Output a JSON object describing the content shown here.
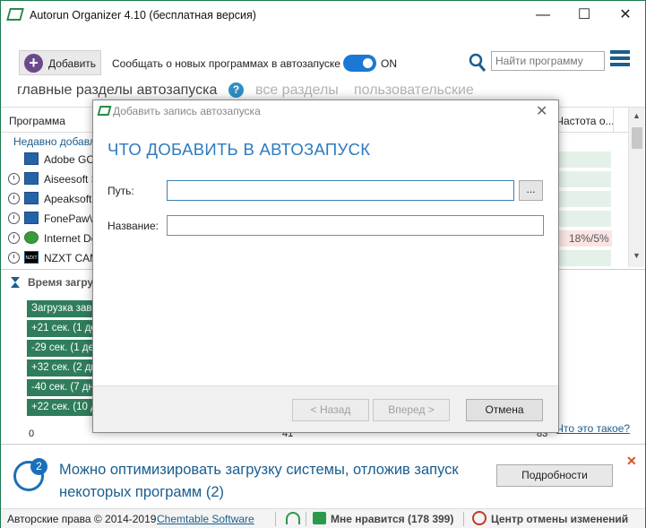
{
  "window": {
    "title": "Autorun Organizer 4.10 (бесплатная версия)",
    "controls": {
      "minimize": "—",
      "maximize": "☐",
      "close": "✕"
    }
  },
  "toolbar": {
    "add_label": "Добавить",
    "add_symbol": "+",
    "notify_text": "Сообщать о новых программах в автозапуске",
    "toggle_label": "ON",
    "toggle_on": true,
    "search_placeholder": "Найти программу"
  },
  "sections": {
    "active": "главные разделы автозапуска",
    "help": "?",
    "all": "все разделы",
    "user": "пользовательские"
  },
  "list": {
    "col_program": "Программа",
    "col_freq": "Частота о...",
    "group": "Недавно добавл...",
    "rows": [
      {
        "name": "Adobe GC...",
        "value": ""
      },
      {
        "name": "Aiseesoft S...",
        "value": ""
      },
      {
        "name": "Apeaksoft ...",
        "value": ""
      },
      {
        "name": "FonePaw\\...",
        "value": ""
      },
      {
        "name": "Internet Do...",
        "value": "18%/5%"
      },
      {
        "name": "NZXT CAM...",
        "value": ""
      }
    ],
    "nzxt_icon_text": "NZXT"
  },
  "boot": {
    "title": "Время загрузки",
    "rows": [
      "Загрузка завершена",
      "+21 сек. (1 день назад)",
      "-29 сек. (1 день назад)",
      "+32 сек. (2 дня назад)",
      "-40 сек. (7 дней назад)",
      "+22 сек. (10 дней назад)"
    ],
    "axis_zero": "0",
    "axis_mid": "41",
    "axis_end": "83",
    "whatis": "Что это такое?"
  },
  "tip": {
    "badge": "2",
    "text": "Можно оптимизировать загрузку системы, отложив запуск некоторых программ (2)",
    "button": "Подробности",
    "close": "✕"
  },
  "status": {
    "copyright": "Авторские права © 2014-2019",
    "link": "Chemtable Software",
    "like": "Мне нравится (178 399)",
    "undo": "Центр отмены изменений"
  },
  "dialog": {
    "title": "Добавить запись автозапуска",
    "close": "✕",
    "heading": "ЧТО ДОБАВИТЬ В АВТОЗАПУСК",
    "path_label": "Путь:",
    "path_value": "",
    "browse": "...",
    "name_label": "Название:",
    "name_value": "",
    "back": "< Назад",
    "next": "Вперед >",
    "cancel": "Отмена"
  },
  "colors": {
    "accent": "#1b78d6",
    "boot_bar": "#2f7d5c",
    "link": "#1a5e8e",
    "heading": "#2e7bbf"
  }
}
